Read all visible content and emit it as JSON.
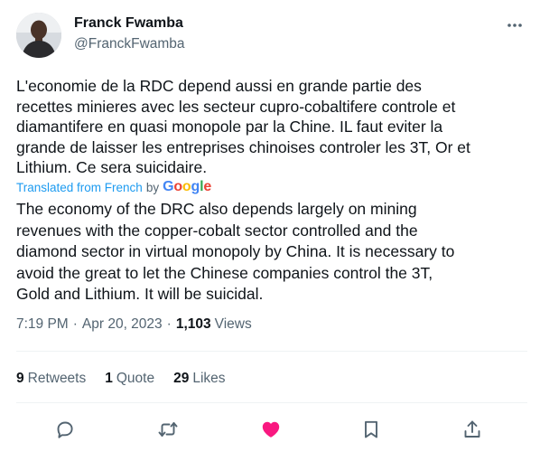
{
  "author": {
    "name": "Franck Fwamba",
    "handle": "@FranckFwamba"
  },
  "tweet": {
    "original_text": "L'economie de la RDC depend aussi en grande partie des\nrecettes minieres avec les secteur cupro-cobaltifere controle et\ndiamantifere en quasi monopole par la Chine. IL faut eviter la\ngrande de laisser les entreprises chinoises controler les 3T, Or et\nLithium. Ce sera suicidaire.",
    "translated_label": "Translated from French",
    "by_label": "by",
    "google_logo_text": "Google",
    "translation_text": "The economy of the DRC also depends largely on mining\nrevenues with the copper-cobalt sector controlled and the\ndiamond sector in virtual monopoly by China. It is necessary to\navoid the great to let the Chinese companies control the 3T,\nGold and Lithium. It will be suicidal."
  },
  "meta": {
    "time": "7:19 PM",
    "separator": "·",
    "date": "Apr 20, 2023",
    "views_count": "1,103",
    "views_label": "Views"
  },
  "stats": {
    "retweets_count": "9",
    "retweets_label": "Retweets",
    "quotes_count": "1",
    "quotes_label": "Quote",
    "likes_count": "29",
    "likes_label": "Likes"
  },
  "actions": {
    "reply_icon": "reply-icon",
    "retweet_icon": "retweet-icon",
    "like_icon": "heart-icon",
    "bookmark_icon": "bookmark-icon",
    "share_icon": "share-icon"
  },
  "colors": {
    "link_blue": "#1d9bf0",
    "like_pink": "#f91880",
    "secondary_text": "#536471",
    "primary_text": "#0f1419"
  }
}
